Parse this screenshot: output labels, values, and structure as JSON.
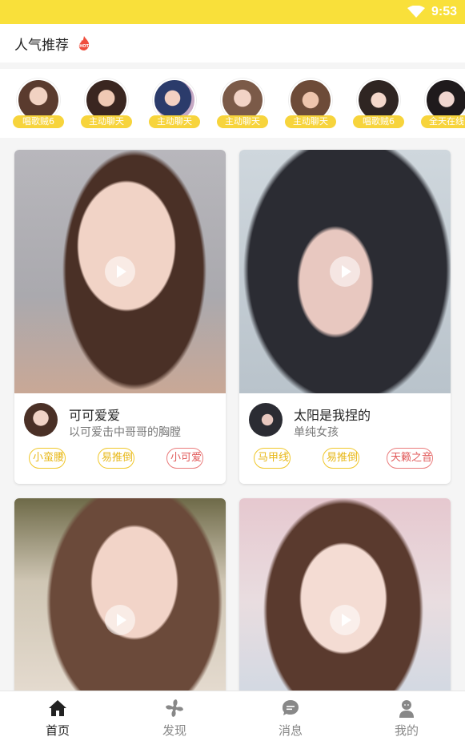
{
  "status": {
    "time": "9:53"
  },
  "header": {
    "title": "人气推荐"
  },
  "recommend": [
    {
      "label": "唱歌贼6"
    },
    {
      "label": "主动聊天"
    },
    {
      "label": "主动聊天"
    },
    {
      "label": "主动聊天"
    },
    {
      "label": "主动聊天"
    },
    {
      "label": "唱歌贼6"
    },
    {
      "label": "全天在线"
    }
  ],
  "cards": [
    {
      "name": "可可爱爱",
      "subtitle": "以可爱击中哥哥的胸膛",
      "tags": [
        "小蛮腰",
        "易推倒",
        "小可爱"
      ]
    },
    {
      "name": "太阳是我捏的",
      "subtitle": "单纯女孩",
      "tags": [
        "马甲线",
        "易推倒",
        "天籁之音"
      ]
    },
    {
      "name": "",
      "subtitle": "",
      "tags": []
    },
    {
      "name": "",
      "subtitle": "",
      "tags": []
    }
  ],
  "nav": [
    {
      "label": "首页",
      "active": true
    },
    {
      "label": "发现",
      "active": false
    },
    {
      "label": "消息",
      "active": false
    },
    {
      "label": "我的",
      "active": false
    }
  ],
  "colors": {
    "accent": "#f9e03a",
    "tag_yellow": "#f0c72a",
    "tag_red": "#ea7b7b"
  }
}
